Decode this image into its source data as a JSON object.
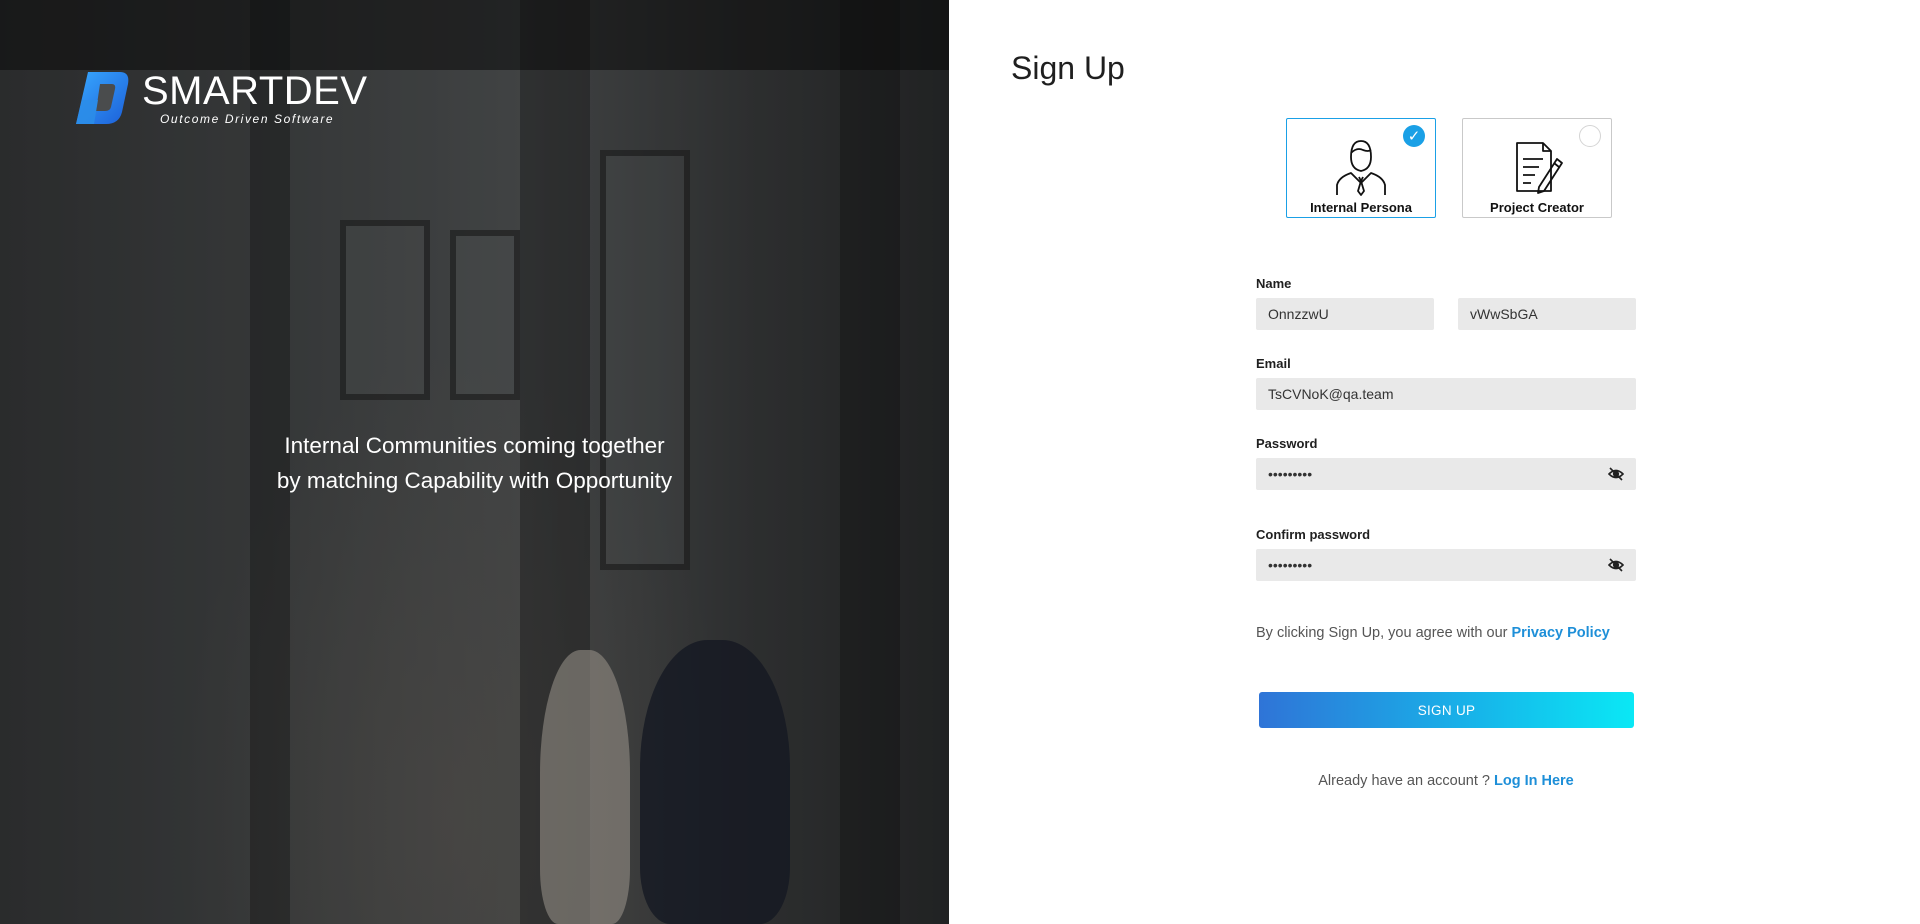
{
  "brand": {
    "name": "SMARTDEV",
    "tagline": "Outcome Driven Software"
  },
  "hero": {
    "line1": "Internal Communities coming together",
    "line2": "by matching Capability with Opportunity"
  },
  "form": {
    "title": "Sign Up",
    "roles": [
      {
        "label": "Internal Persona",
        "selected": true,
        "icon": "person-icon"
      },
      {
        "label": "Project Creator",
        "selected": false,
        "icon": "document-pen-icon"
      }
    ],
    "name_label": "Name",
    "first_name_value": "OnnzzwU",
    "last_name_value": "vWwSbGA",
    "email_label": "Email",
    "email_value": "TsCVNoK@qa.team",
    "password_label": "Password",
    "password_value": "•••••••••",
    "confirm_label": "Confirm password",
    "confirm_value": "•••••••••",
    "privacy_text": "By clicking Sign Up, you agree with our",
    "privacy_link": "Privacy Policy",
    "signup_button": "SIGN UP",
    "login_text": "Already have an account ?",
    "login_link": "Log In Here"
  },
  "colors": {
    "accent": "#1aa0e6",
    "button_start": "#2f74d7",
    "button_end": "#0ae8f5"
  }
}
